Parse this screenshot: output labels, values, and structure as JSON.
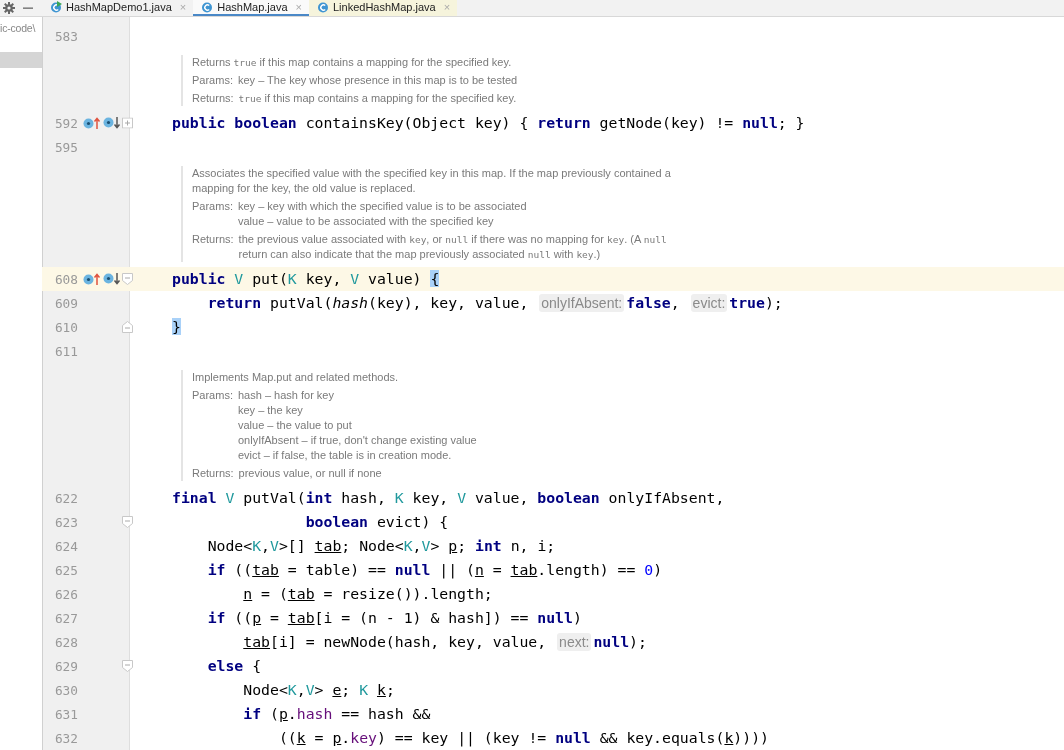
{
  "toolbar": {
    "buttons": [
      {
        "kind": "settings"
      },
      {
        "kind": "hide"
      }
    ]
  },
  "tabs": [
    {
      "label": "HashMapDemo1.java",
      "close": "×",
      "selected": false,
      "runnable": true,
      "highlighted": false
    },
    {
      "label": "HashMap.java",
      "close": "×",
      "selected": true,
      "runnable": false,
      "highlighted": false
    },
    {
      "label": "LinkedHashMap.java",
      "close": "×",
      "selected": false,
      "runnable": false,
      "highlighted": true
    }
  ],
  "project_panel": {
    "path": "ic-code\\",
    "highlighted_row": true
  },
  "editor": {
    "lines": [
      {
        "kind": "code",
        "number": "583",
        "overrides": false,
        "current": false
      },
      {
        "kind": "doc",
        "sections": [
          {
            "lines": [
              [
                {
                  "kind": "text",
                  "text": "Returns "
                },
                {
                  "kind": "code",
                  "text": "true"
                },
                {
                  "kind": "text",
                  "text": " if this map contains a mapping for the specified key."
                }
              ]
            ]
          },
          {
            "label": "Params:",
            "lines": [
              "key – The key whose presence in this map is to be tested"
            ]
          },
          {
            "label": "Returns:",
            "lines": [
              [
                {
                  "kind": "code",
                  "text": "true"
                },
                {
                  "kind": "text",
                  "text": " if this map contains a mapping for the specified key."
                }
              ]
            ]
          }
        ]
      },
      {
        "kind": "code",
        "number": "592",
        "overrides": true,
        "fold": {
          "kind": "plus"
        },
        "current": false,
        "tokens": [
          {
            "kind": "kw",
            "text": "public boolean"
          },
          {
            "kind": "plain",
            "text": " containsKey(Object key) { "
          },
          {
            "kind": "kw",
            "text": "return"
          },
          {
            "kind": "plain",
            "text": " getNode(key) != "
          },
          {
            "kind": "kw",
            "text": "null"
          },
          {
            "kind": "plain",
            "text": "; }"
          }
        ]
      },
      {
        "kind": "code",
        "number": "595",
        "overrides": false,
        "current": false
      },
      {
        "kind": "doc",
        "sections": [
          {
            "lines": [
              "Associates the specified value with the specified key in this map. If the map previously contained a mapping for the key, the old value is replaced."
            ]
          },
          {
            "label": "Params:",
            "lines": [
              "key – key with which the specified value is to be associated",
              "value – value to be associated with the specified key"
            ]
          },
          {
            "label": "Returns:",
            "lines": [
              [
                {
                  "kind": "text",
                  "text": "the previous value associated with "
                },
                {
                  "kind": "code",
                  "text": "key"
                },
                {
                  "kind": "text",
                  "text": ", or "
                },
                {
                  "kind": "code",
                  "text": "null"
                },
                {
                  "kind": "text",
                  "text": " if there was no mapping for "
                },
                {
                  "kind": "code",
                  "text": "key"
                },
                {
                  "kind": "text",
                  "text": ". (A "
                },
                {
                  "kind": "code",
                  "text": "null"
                },
                {
                  "kind": "text",
                  "text": " return can also indicate that the map previously associated "
                },
                {
                  "kind": "code",
                  "text": "null"
                },
                {
                  "kind": "text",
                  "text": " with "
                },
                {
                  "kind": "code",
                  "text": "key"
                },
                {
                  "kind": "text",
                  "text": ".)"
                }
              ]
            ]
          }
        ]
      },
      {
        "kind": "code",
        "number": "608",
        "overrides": true,
        "fold": {
          "kind": "start"
        },
        "current": true,
        "tokens": [
          {
            "kind": "kw",
            "text": "public "
          },
          {
            "kind": "type",
            "text": "V"
          },
          {
            "kind": "plain",
            "text": " put("
          },
          {
            "kind": "type",
            "text": "K"
          },
          {
            "kind": "plain",
            "text": " key, "
          },
          {
            "kind": "type",
            "text": "V"
          },
          {
            "kind": "plain",
            "text": " value) "
          },
          {
            "kind": "brace",
            "text": "{"
          }
        ]
      },
      {
        "kind": "code",
        "number": "609",
        "overrides": false,
        "current": false,
        "tokens": [
          {
            "kind": "kw",
            "text": "    return"
          },
          {
            "kind": "plain",
            "text": " putVal("
          },
          {
            "kind": "italic",
            "text": "hash"
          },
          {
            "kind": "plain",
            "text": "(key), key, value, "
          },
          {
            "kind": "hint",
            "text": "onlyIfAbsent:"
          },
          {
            "kind": "kw",
            "text": "false"
          },
          {
            "kind": "plain",
            "text": ", "
          },
          {
            "kind": "hint",
            "text": "evict:"
          },
          {
            "kind": "kw",
            "text": "true"
          },
          {
            "kind": "plain",
            "text": ");"
          }
        ]
      },
      {
        "kind": "code",
        "number": "610",
        "overrides": false,
        "fold": {
          "kind": "end"
        },
        "current": false,
        "tokens": [
          {
            "kind": "brace",
            "text": "}"
          }
        ]
      },
      {
        "kind": "code",
        "number": "611",
        "overrides": false,
        "current": false
      },
      {
        "kind": "doc",
        "sections": [
          {
            "lines": [
              "Implements Map.put and related methods."
            ]
          },
          {
            "label": "Params:",
            "lines": [
              "hash – hash for key",
              "key – the key",
              "value – the value to put",
              "onlyIfAbsent – if true, don't change existing value",
              "evict – if false, the table is in creation mode."
            ]
          },
          {
            "label": "Returns:",
            "lines": [
              "previous value, or null if none"
            ]
          }
        ]
      },
      {
        "kind": "code",
        "number": "622",
        "overrides": false,
        "current": false,
        "tokens": [
          {
            "kind": "kw",
            "text": "final "
          },
          {
            "kind": "type",
            "text": "V"
          },
          {
            "kind": "plain",
            "text": " putVal("
          },
          {
            "kind": "kw",
            "text": "int"
          },
          {
            "kind": "plain",
            "text": " hash, "
          },
          {
            "kind": "type",
            "text": "K"
          },
          {
            "kind": "plain",
            "text": " key, "
          },
          {
            "kind": "type",
            "text": "V"
          },
          {
            "kind": "plain",
            "text": " value, "
          },
          {
            "kind": "kw",
            "text": "boolean"
          },
          {
            "kind": "plain",
            "text": " onlyIfAbsent,"
          }
        ]
      },
      {
        "kind": "code",
        "number": "623",
        "overrides": false,
        "fold": {
          "kind": "start"
        },
        "current": false,
        "tokens": [
          {
            "kind": "kw",
            "text": "               boolean"
          },
          {
            "kind": "plain",
            "text": " evict) {"
          }
        ]
      },
      {
        "kind": "code",
        "number": "624",
        "overrides": false,
        "current": false,
        "tokens": [
          {
            "kind": "plain",
            "text": "    Node<"
          },
          {
            "kind": "type",
            "text": "K"
          },
          {
            "kind": "plain",
            "text": ","
          },
          {
            "kind": "type",
            "text": "V"
          },
          {
            "kind": "plain",
            "text": ">[] "
          },
          {
            "kind": "var",
            "text": "tab"
          },
          {
            "kind": "plain",
            "text": "; Node<"
          },
          {
            "kind": "type",
            "text": "K"
          },
          {
            "kind": "plain",
            "text": ","
          },
          {
            "kind": "type",
            "text": "V"
          },
          {
            "kind": "plain",
            "text": "> "
          },
          {
            "kind": "var",
            "text": "p"
          },
          {
            "kind": "plain",
            "text": "; "
          },
          {
            "kind": "kw",
            "text": "int"
          },
          {
            "kind": "plain",
            "text": " n, i;"
          }
        ]
      },
      {
        "kind": "code",
        "number": "625",
        "overrides": false,
        "current": false,
        "tokens": [
          {
            "kind": "kw",
            "text": "    if"
          },
          {
            "kind": "plain",
            "text": " (("
          },
          {
            "kind": "var",
            "text": "tab"
          },
          {
            "kind": "plain",
            "text": " = table) == "
          },
          {
            "kind": "kw",
            "text": "null"
          },
          {
            "kind": "plain",
            "text": " || ("
          },
          {
            "kind": "var",
            "text": "n"
          },
          {
            "kind": "plain",
            "text": " = "
          },
          {
            "kind": "var",
            "text": "tab"
          },
          {
            "kind": "plain",
            "text": ".length) == "
          },
          {
            "kind": "num",
            "text": "0"
          },
          {
            "kind": "plain",
            "text": ")"
          }
        ]
      },
      {
        "kind": "code",
        "number": "626",
        "overrides": false,
        "current": false,
        "tokens": [
          {
            "kind": "var",
            "text": "        n"
          },
          {
            "kind": "plain",
            "text": " = ("
          },
          {
            "kind": "var",
            "text": "tab"
          },
          {
            "kind": "plain",
            "text": " = resize()).length;"
          }
        ]
      },
      {
        "kind": "code",
        "number": "627",
        "overrides": false,
        "current": false,
        "tokens": [
          {
            "kind": "kw",
            "text": "    if"
          },
          {
            "kind": "plain",
            "text": " (("
          },
          {
            "kind": "var",
            "text": "p"
          },
          {
            "kind": "plain",
            "text": " = "
          },
          {
            "kind": "var",
            "text": "tab"
          },
          {
            "kind": "plain",
            "text": "[i = (n - 1) & hash]) == "
          },
          {
            "kind": "kw",
            "text": "null"
          },
          {
            "kind": "plain",
            "text": ")"
          }
        ]
      },
      {
        "kind": "code",
        "number": "628",
        "overrides": false,
        "current": false,
        "tokens": [
          {
            "kind": "var",
            "text": "        tab"
          },
          {
            "kind": "plain",
            "text": "[i] = newNode(hash, key, value, "
          },
          {
            "kind": "hint",
            "text": "next:"
          },
          {
            "kind": "kw",
            "text": "null"
          },
          {
            "kind": "plain",
            "text": ");"
          }
        ]
      },
      {
        "kind": "code",
        "number": "629",
        "overrides": false,
        "fold": {
          "kind": "start"
        },
        "current": false,
        "tokens": [
          {
            "kind": "kw",
            "text": "    else"
          },
          {
            "kind": "plain",
            "text": " {"
          }
        ]
      },
      {
        "kind": "code",
        "number": "630",
        "overrides": false,
        "current": false,
        "tokens": [
          {
            "kind": "plain",
            "text": "        Node<"
          },
          {
            "kind": "type",
            "text": "K"
          },
          {
            "kind": "plain",
            "text": ","
          },
          {
            "kind": "type",
            "text": "V"
          },
          {
            "kind": "plain",
            "text": "> "
          },
          {
            "kind": "var",
            "text": "e"
          },
          {
            "kind": "plain",
            "text": "; "
          },
          {
            "kind": "type",
            "text": "K "
          },
          {
            "kind": "var",
            "text": "k"
          },
          {
            "kind": "plain",
            "text": ";"
          }
        ]
      },
      {
        "kind": "code",
        "number": "631",
        "overrides": false,
        "current": false,
        "tokens": [
          {
            "kind": "kw",
            "text": "        if"
          },
          {
            "kind": "plain",
            "text": " ("
          },
          {
            "kind": "var",
            "text": "p"
          },
          {
            "kind": "plain",
            "text": "."
          },
          {
            "kind": "field",
            "text": "hash"
          },
          {
            "kind": "plain",
            "text": " == hash &&"
          }
        ]
      },
      {
        "kind": "code",
        "number": "632",
        "overrides": false,
        "current": false,
        "tokens": [
          {
            "kind": "plain",
            "text": "            (("
          },
          {
            "kind": "var",
            "text": "k"
          },
          {
            "kind": "plain",
            "text": " = "
          },
          {
            "kind": "var",
            "text": "p"
          },
          {
            "kind": "plain",
            "text": "."
          },
          {
            "kind": "field",
            "text": "key"
          },
          {
            "kind": "plain",
            "text": ") == key || (key != "
          },
          {
            "kind": "kw",
            "text": "null"
          },
          {
            "kind": "plain",
            "text": " && key.equals("
          },
          {
            "kind": "var",
            "text": "k"
          },
          {
            "kind": "plain",
            "text": "))))"
          }
        ]
      }
    ]
  }
}
